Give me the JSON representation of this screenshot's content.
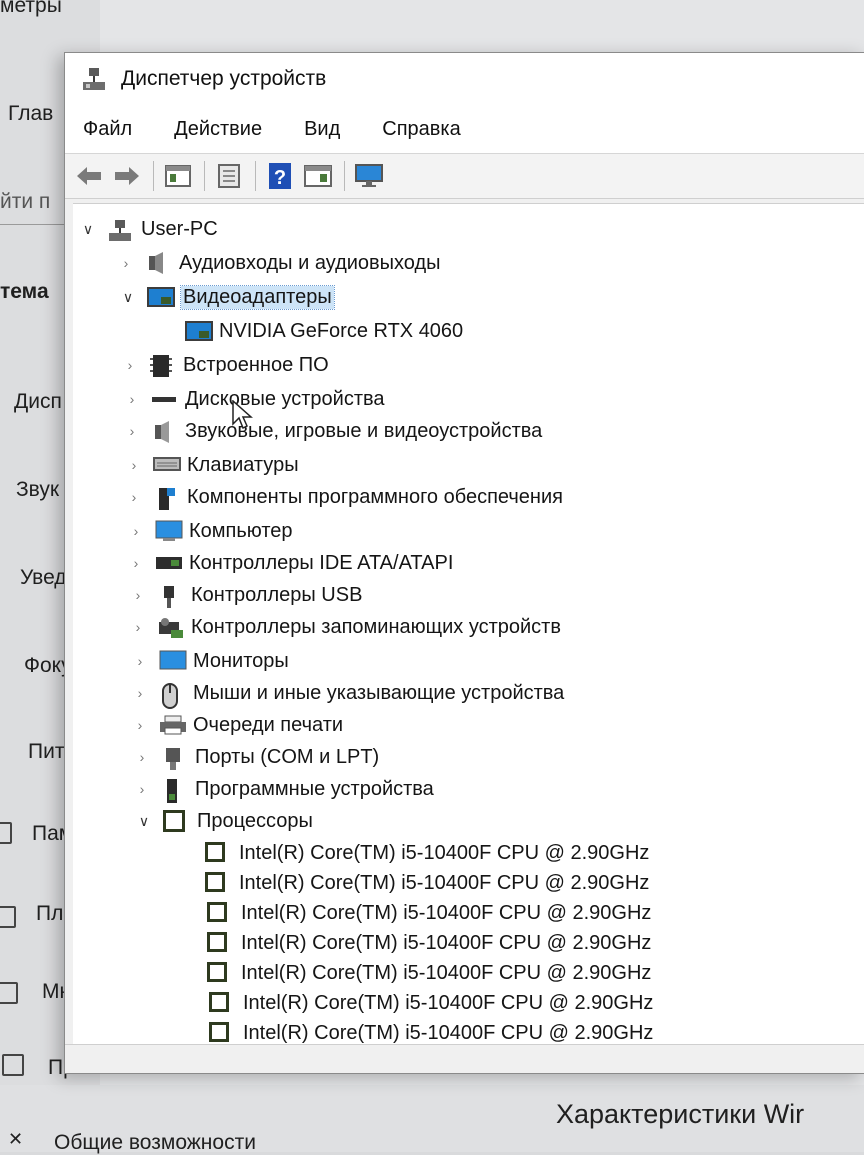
{
  "background": {
    "title_fragment": "метры",
    "home_fragment": "Глав",
    "search_fragment": "йти п",
    "section_fragment": "тема",
    "menu_fragments": [
      "Дисп",
      "Звук",
      "Увед",
      "Фоку",
      "Пита",
      "Памя",
      "План",
      "Мно",
      "Прое"
    ],
    "accessibility_label": "Общие возможности",
    "specs_heading": "Характеристики Wir"
  },
  "window": {
    "title": "Диспетчер устройств",
    "menu": [
      "Файл",
      "Действие",
      "Вид",
      "Справка"
    ],
    "toolbar": [
      "back-icon",
      "forward-icon",
      "properties-icon",
      "update-icon",
      "help-icon",
      "view-icon",
      "monitor-icon"
    ]
  },
  "tree": {
    "root": "User-PC",
    "categories": [
      {
        "label": "Аудиовходы и аудиовыходы",
        "icon": "speaker-icon",
        "expanded": false
      },
      {
        "label": "Видеоадаптеры",
        "icon": "display-adapter-icon",
        "expanded": true,
        "selected": true
      },
      {
        "label": "Встроенное ПО",
        "icon": "firmware-icon",
        "expanded": false
      },
      {
        "label": "Дисковые устройства",
        "icon": "disk-icon",
        "expanded": false
      },
      {
        "label": "Звуковые, игровые и видеоустройства",
        "icon": "sound-icon",
        "expanded": false
      },
      {
        "label": "Клавиатуры",
        "icon": "keyboard-icon",
        "expanded": false
      },
      {
        "label": "Компоненты программного обеспечения",
        "icon": "software-component-icon",
        "expanded": false
      },
      {
        "label": "Компьютер",
        "icon": "computer-icon",
        "expanded": false
      },
      {
        "label": "Контроллеры IDE ATA/ATAPI",
        "icon": "ide-controller-icon",
        "expanded": false
      },
      {
        "label": "Контроллеры USB",
        "icon": "usb-icon",
        "expanded": false
      },
      {
        "label": "Контроллеры запоминающих устройств",
        "icon": "storage-controller-icon",
        "expanded": false
      },
      {
        "label": "Мониторы",
        "icon": "monitor-icon",
        "expanded": false
      },
      {
        "label": "Мыши и иные указывающие устройства",
        "icon": "mouse-icon",
        "expanded": false
      },
      {
        "label": "Очереди печати",
        "icon": "printer-icon",
        "expanded": false
      },
      {
        "label": "Порты (COM и LPT)",
        "icon": "port-icon",
        "expanded": false
      },
      {
        "label": "Программные устройства",
        "icon": "software-device-icon",
        "expanded": false
      },
      {
        "label": "Процессоры",
        "icon": "processor-icon",
        "expanded": true
      }
    ],
    "video_adapter": "NVIDIA GeForce RTX 4060",
    "processor": "Intel(R) Core(TM) i5-10400F CPU @ 2.90GHz",
    "processor_rows_visible": 7
  },
  "colors": {
    "selection": "#cde4f7",
    "accent_blue": "#1e7fd0",
    "cpu_green": "#2e3a1f"
  }
}
